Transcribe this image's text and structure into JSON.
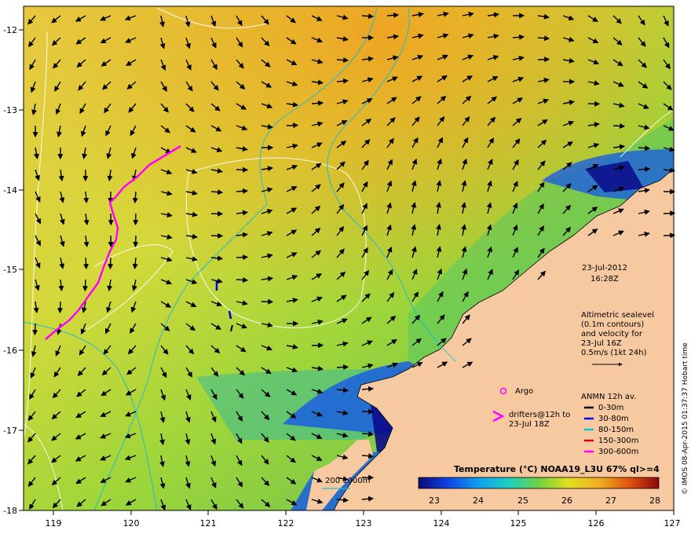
{
  "map": {
    "lat_ticks": [
      "-12",
      "-13",
      "-14",
      "-15",
      "-16",
      "-17",
      "-18"
    ],
    "lon_ticks": [
      "119",
      "120",
      "121",
      "122",
      "123",
      "124",
      "125",
      "126",
      "127"
    ],
    "date": "23-Jul-2012",
    "time": "16:28Z",
    "alt_lines": [
      "Altimetric sealevel",
      "(0.1m contours)",
      "and velocity for",
      "23-Jul 16Z",
      "0.5m/s (1kt 24h)"
    ],
    "argo_label": "Argo",
    "drifter_lines": [
      "drifters@12h to",
      "23-Jul 18Z"
    ],
    "anmn_title": "ANMN 12h av.",
    "anmn_items": [
      {
        "label": "0-30m",
        "color": "#000000"
      },
      {
        "label": "30-80m",
        "color": "#0000dd"
      },
      {
        "label": "80-150m",
        "color": "#00cccc"
      },
      {
        "label": "150-300m",
        "color": "#dd0000"
      },
      {
        "label": "300-600m",
        "color": "#ff00ff"
      }
    ],
    "depth_legend": "200  1000m",
    "colorbar_title": "Temperature (°C) NOAA19_L3U 67% ql>=4",
    "colorbar_ticks": [
      "23",
      "24",
      "25",
      "26",
      "27",
      "28"
    ],
    "copyright": "© IMOS 08-Apr-2015 01:37:37 Hobart time",
    "colors": {
      "land": "#f7c9a0",
      "drifter": "#ff00ff",
      "contour": "#ffffff",
      "isobath": "#22bbcc"
    }
  }
}
